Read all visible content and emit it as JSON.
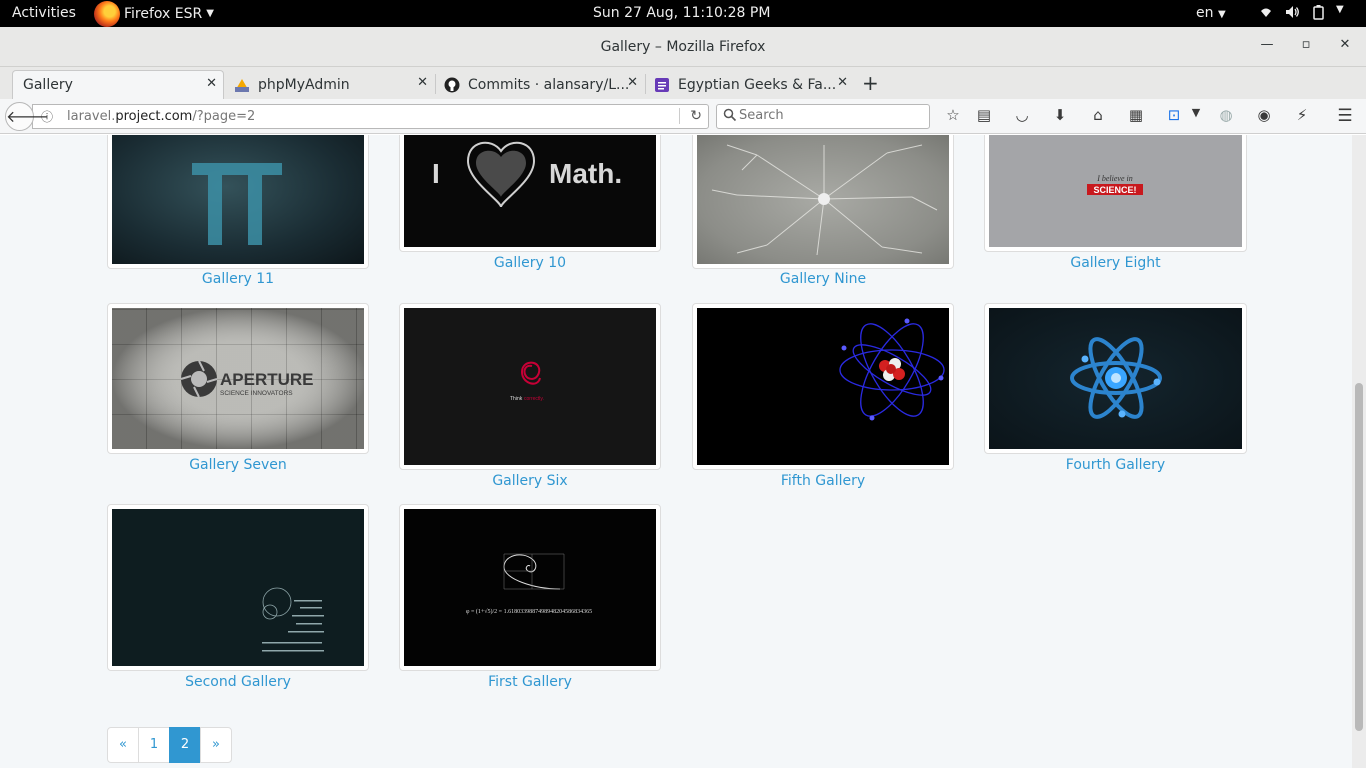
{
  "topbar": {
    "activities": "Activities",
    "app_name": "Firefox ESR",
    "clock": "Sun 27 Aug, 11:10:28 PM",
    "lang": "en"
  },
  "window": {
    "title": "Gallery – Mozilla Firefox"
  },
  "tabs": [
    {
      "label": "Gallery",
      "active": true
    },
    {
      "label": "phpMyAdmin"
    },
    {
      "label": "Commits · alansary/L..."
    },
    {
      "label": "Egyptian Geeks & Fa..."
    }
  ],
  "navbar": {
    "url_prefix": "laravel.",
    "url_domain": "project.com",
    "url_path": "/?page=2",
    "search_placeholder": "Search"
  },
  "galleries": [
    {
      "name": "Gallery 11",
      "art": "pi"
    },
    {
      "name": "Gallery 10",
      "art": "heart",
      "text_left": "I",
      "text_right": "Math."
    },
    {
      "name": "Gallery Nine",
      "art": "mindmap"
    },
    {
      "name": "Gallery Eight",
      "art": "science",
      "line1": "I believe in",
      "line2": "SCIENCE!"
    },
    {
      "name": "Gallery Seven",
      "art": "aperture",
      "line1": "APERTURE",
      "line2": "SCIENCE INNOVATORS"
    },
    {
      "name": "Gallery Six",
      "art": "debian",
      "line1": "Think",
      "line2": "correctly."
    },
    {
      "name": "Fifth Gallery",
      "art": "atom-red"
    },
    {
      "name": "Fourth Gallery",
      "art": "atom-blue"
    },
    {
      "name": "Second Gallery",
      "art": "formulas"
    },
    {
      "name": "First Gallery",
      "art": "golden",
      "formula": "φ = (1+√5)/2 = 1.6180339887498948204586834365"
    }
  ],
  "pagination": {
    "prev": "«",
    "pages": [
      "1",
      "2"
    ],
    "current": "2",
    "next": "»"
  },
  "colors": {
    "link": "#3097d1",
    "page_bg": "#f4f7f9",
    "topbar": "#000000"
  }
}
